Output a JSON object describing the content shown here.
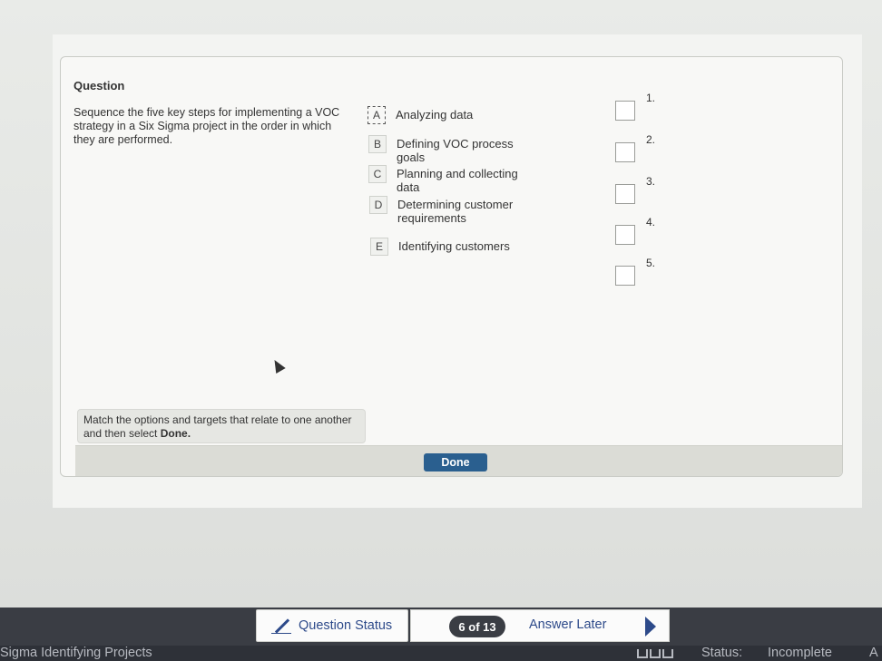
{
  "question": {
    "title": "Question",
    "text": "Sequence the five key steps for implementing a VOC strategy in a Six Sigma project in the order in which they are performed.",
    "instruction_prefix": "Match the options and targets that relate to one another and then select ",
    "instruction_bold": "Done.",
    "done_label": "Done"
  },
  "options": [
    {
      "letter": "A",
      "text": "Analyzing data"
    },
    {
      "letter": "B",
      "text": "Defining VOC process goals"
    },
    {
      "letter": "C",
      "text": "Planning and collecting data"
    },
    {
      "letter": "D",
      "text": "Determining customer requirements"
    },
    {
      "letter": "E",
      "text": "Identifying customers"
    }
  ],
  "targets": [
    "1.",
    "2.",
    "3.",
    "4.",
    "5."
  ],
  "toolbar": {
    "question_status_label": "Question Status",
    "page_indicator": "6 of 13",
    "answer_later_label": "Answer Later"
  },
  "status_bar": {
    "course_title": "Sigma Identifying Projects",
    "status_label": "Status:",
    "status_value": "Incomplete",
    "extra": "A"
  }
}
